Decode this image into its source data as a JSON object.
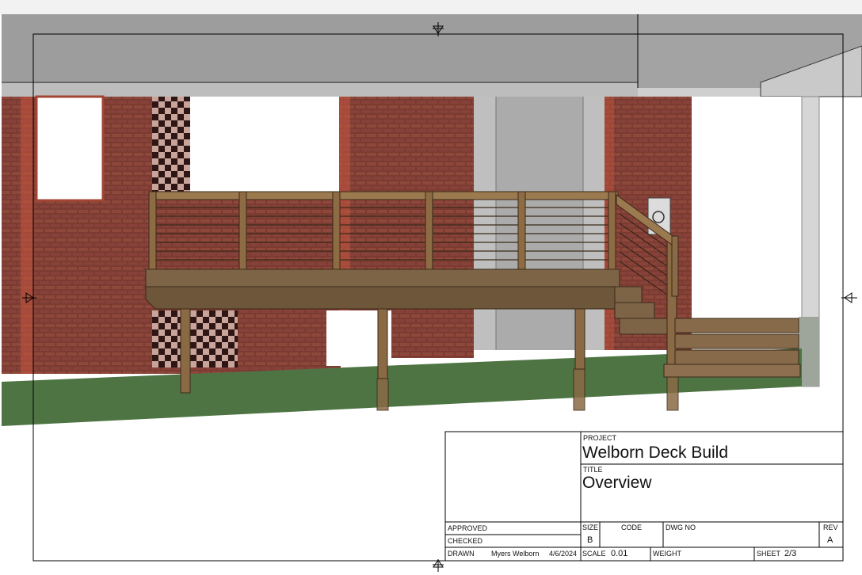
{
  "title_block": {
    "project_label": "PROJECT",
    "project": "Welborn Deck Build",
    "title_label": "TITLE",
    "title": "Overview",
    "approved_label": "APPROVED",
    "checked_label": "CHECKED",
    "drawn_label": "DRAWN",
    "drawn_by": "Myers Welborn",
    "drawn_date": "4/6/2024",
    "size_label": "SIZE",
    "size": "B",
    "code_label": "CODE",
    "dwg_no_label": "DWG NO",
    "rev_label": "REV",
    "rev": "A",
    "scale_label": "SCALE",
    "scale": "0.01",
    "weight_label": "WEIGHT",
    "sheet_label": "SHEET",
    "sheet": "2/3"
  },
  "colors": {
    "brick": "#7a3a30",
    "brick_trim": "#c8553f",
    "roof": "#9b9b9b",
    "wood": "#8a6a45",
    "lawn": "#4f7444",
    "frame": "#000000"
  },
  "icons": [
    "section-arrow-icon",
    "utility-meter-icon"
  ]
}
